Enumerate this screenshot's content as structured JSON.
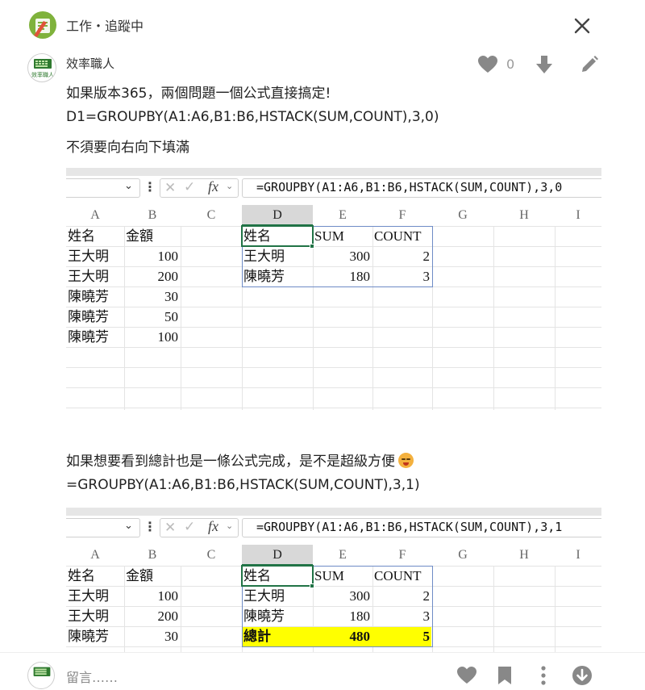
{
  "header": {
    "board_name": "工作・追蹤中"
  },
  "post": {
    "author": "效率職人",
    "avatar_text": "效率職人",
    "like_count": "0",
    "lines": [
      "如果版本365，兩個問題一個公式直接搞定!",
      "D1=GROUPBY(A1:A6,B1:B6,HSTACK(SUM,COUNT),3,0)",
      "不須要向右向下填滿"
    ],
    "lines2": [
      "如果想要看到總計也是一條公式完成，是不是超級方便",
      "=GROUPBY(A1:A6,B1:B6,HSTACK(SUM,COUNT),3,1)"
    ]
  },
  "excel1": {
    "formula": "=GROUPBY(A1:A6,B1:B6,HSTACK(SUM,COUNT),3,0",
    "columns": [
      "A",
      "B",
      "C",
      "D",
      "E",
      "F",
      "G",
      "H",
      "I"
    ],
    "colA": [
      "姓名",
      "王大明",
      "王大明",
      "陳曉芳",
      "陳曉芳",
      "陳曉芳"
    ],
    "colB": [
      "金額",
      "100",
      "200",
      "30",
      "50",
      "100"
    ],
    "result_header": [
      "姓名",
      "SUM",
      "COUNT"
    ],
    "result_rows": [
      [
        "王大明",
        "300",
        "2"
      ],
      [
        "陳曉芳",
        "180",
        "3"
      ]
    ]
  },
  "excel2": {
    "formula": "=GROUPBY(A1:A6,B1:B6,HSTACK(SUM,COUNT),3,1",
    "columns": [
      "A",
      "B",
      "C",
      "D",
      "E",
      "F",
      "G",
      "H",
      "I"
    ],
    "colA": [
      "姓名",
      "王大明",
      "王大明",
      "陳曉芳"
    ],
    "colB": [
      "金額",
      "100",
      "200",
      "30"
    ],
    "result_header": [
      "姓名",
      "SUM",
      "COUNT"
    ],
    "result_rows": [
      [
        "王大明",
        "300",
        "2"
      ],
      [
        "陳曉芳",
        "180",
        "3"
      ],
      [
        "總計",
        "480",
        "5"
      ]
    ],
    "highlight_color": "#ffff00"
  },
  "comment": {
    "placeholder": "留言……"
  },
  "colors": {
    "excel_green": "#217346",
    "icon_gray": "#888888",
    "spill_border": "#6e8cc6"
  }
}
